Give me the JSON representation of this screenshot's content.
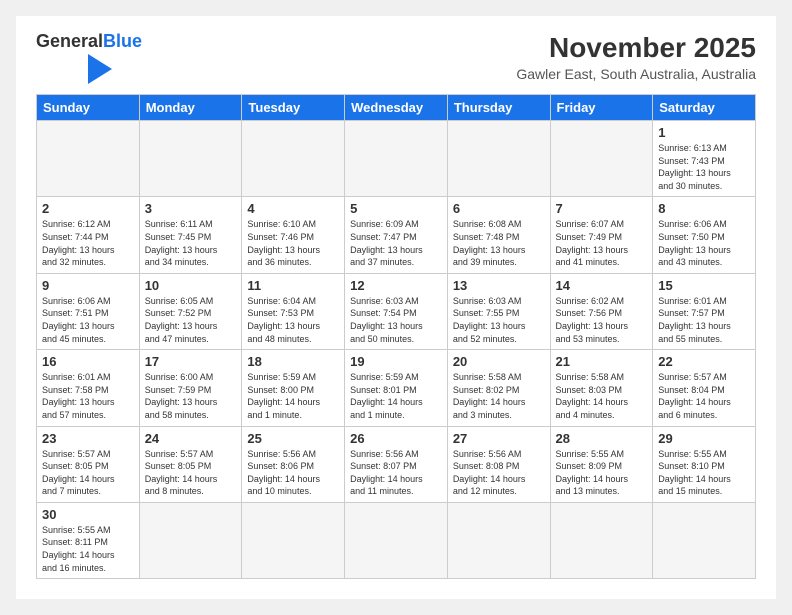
{
  "header": {
    "logo_general": "General",
    "logo_blue": "Blue",
    "title": "November 2025",
    "subtitle": "Gawler East, South Australia, Australia"
  },
  "days_of_week": [
    "Sunday",
    "Monday",
    "Tuesday",
    "Wednesday",
    "Thursday",
    "Friday",
    "Saturday"
  ],
  "weeks": [
    [
      {
        "day": "",
        "info": ""
      },
      {
        "day": "",
        "info": ""
      },
      {
        "day": "",
        "info": ""
      },
      {
        "day": "",
        "info": ""
      },
      {
        "day": "",
        "info": ""
      },
      {
        "day": "",
        "info": ""
      },
      {
        "day": "1",
        "info": "Sunrise: 6:13 AM\nSunset: 7:43 PM\nDaylight: 13 hours\nand 30 minutes."
      }
    ],
    [
      {
        "day": "2",
        "info": "Sunrise: 6:12 AM\nSunset: 7:44 PM\nDaylight: 13 hours\nand 32 minutes."
      },
      {
        "day": "3",
        "info": "Sunrise: 6:11 AM\nSunset: 7:45 PM\nDaylight: 13 hours\nand 34 minutes."
      },
      {
        "day": "4",
        "info": "Sunrise: 6:10 AM\nSunset: 7:46 PM\nDaylight: 13 hours\nand 36 minutes."
      },
      {
        "day": "5",
        "info": "Sunrise: 6:09 AM\nSunset: 7:47 PM\nDaylight: 13 hours\nand 37 minutes."
      },
      {
        "day": "6",
        "info": "Sunrise: 6:08 AM\nSunset: 7:48 PM\nDaylight: 13 hours\nand 39 minutes."
      },
      {
        "day": "7",
        "info": "Sunrise: 6:07 AM\nSunset: 7:49 PM\nDaylight: 13 hours\nand 41 minutes."
      },
      {
        "day": "8",
        "info": "Sunrise: 6:06 AM\nSunset: 7:50 PM\nDaylight: 13 hours\nand 43 minutes."
      }
    ],
    [
      {
        "day": "9",
        "info": "Sunrise: 6:06 AM\nSunset: 7:51 PM\nDaylight: 13 hours\nand 45 minutes."
      },
      {
        "day": "10",
        "info": "Sunrise: 6:05 AM\nSunset: 7:52 PM\nDaylight: 13 hours\nand 47 minutes."
      },
      {
        "day": "11",
        "info": "Sunrise: 6:04 AM\nSunset: 7:53 PM\nDaylight: 13 hours\nand 48 minutes."
      },
      {
        "day": "12",
        "info": "Sunrise: 6:03 AM\nSunset: 7:54 PM\nDaylight: 13 hours\nand 50 minutes."
      },
      {
        "day": "13",
        "info": "Sunrise: 6:03 AM\nSunset: 7:55 PM\nDaylight: 13 hours\nand 52 minutes."
      },
      {
        "day": "14",
        "info": "Sunrise: 6:02 AM\nSunset: 7:56 PM\nDaylight: 13 hours\nand 53 minutes."
      },
      {
        "day": "15",
        "info": "Sunrise: 6:01 AM\nSunset: 7:57 PM\nDaylight: 13 hours\nand 55 minutes."
      }
    ],
    [
      {
        "day": "16",
        "info": "Sunrise: 6:01 AM\nSunset: 7:58 PM\nDaylight: 13 hours\nand 57 minutes."
      },
      {
        "day": "17",
        "info": "Sunrise: 6:00 AM\nSunset: 7:59 PM\nDaylight: 13 hours\nand 58 minutes."
      },
      {
        "day": "18",
        "info": "Sunrise: 5:59 AM\nSunset: 8:00 PM\nDaylight: 14 hours\nand 1 minute."
      },
      {
        "day": "19",
        "info": "Sunrise: 5:59 AM\nSunset: 8:01 PM\nDaylight: 14 hours\nand 1 minute."
      },
      {
        "day": "20",
        "info": "Sunrise: 5:58 AM\nSunset: 8:02 PM\nDaylight: 14 hours\nand 3 minutes."
      },
      {
        "day": "21",
        "info": "Sunrise: 5:58 AM\nSunset: 8:03 PM\nDaylight: 14 hours\nand 4 minutes."
      },
      {
        "day": "22",
        "info": "Sunrise: 5:57 AM\nSunset: 8:04 PM\nDaylight: 14 hours\nand 6 minutes."
      }
    ],
    [
      {
        "day": "23",
        "info": "Sunrise: 5:57 AM\nSunset: 8:05 PM\nDaylight: 14 hours\nand 7 minutes."
      },
      {
        "day": "24",
        "info": "Sunrise: 5:57 AM\nSunset: 8:05 PM\nDaylight: 14 hours\nand 8 minutes."
      },
      {
        "day": "25",
        "info": "Sunrise: 5:56 AM\nSunset: 8:06 PM\nDaylight: 14 hours\nand 10 minutes."
      },
      {
        "day": "26",
        "info": "Sunrise: 5:56 AM\nSunset: 8:07 PM\nDaylight: 14 hours\nand 11 minutes."
      },
      {
        "day": "27",
        "info": "Sunrise: 5:56 AM\nSunset: 8:08 PM\nDaylight: 14 hours\nand 12 minutes."
      },
      {
        "day": "28",
        "info": "Sunrise: 5:55 AM\nSunset: 8:09 PM\nDaylight: 14 hours\nand 13 minutes."
      },
      {
        "day": "29",
        "info": "Sunrise: 5:55 AM\nSunset: 8:10 PM\nDaylight: 14 hours\nand 15 minutes."
      }
    ],
    [
      {
        "day": "30",
        "info": "Sunrise: 5:55 AM\nSunset: 8:11 PM\nDaylight: 14 hours\nand 16 minutes."
      },
      {
        "day": "",
        "info": ""
      },
      {
        "day": "",
        "info": ""
      },
      {
        "day": "",
        "info": ""
      },
      {
        "day": "",
        "info": ""
      },
      {
        "day": "",
        "info": ""
      },
      {
        "day": "",
        "info": ""
      }
    ]
  ]
}
